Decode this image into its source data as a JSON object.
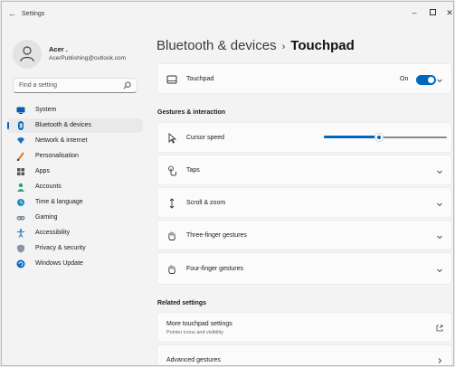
{
  "window": {
    "app_title": "Settings",
    "back_glyph": "←",
    "minimize_glyph": "–",
    "close_glyph": "✕"
  },
  "profile": {
    "name": "Acer .",
    "email": "AcerPublishing@outlook.com"
  },
  "search": {
    "placeholder": "Find a setting",
    "icon": "search-icon"
  },
  "sidebar": {
    "items": [
      {
        "label": "System",
        "icon": "monitor-icon",
        "active": false
      },
      {
        "label": "Bluetooth & devices",
        "icon": "bluetooth-icon",
        "active": true
      },
      {
        "label": "Network & internet",
        "icon": "wifi-icon",
        "active": false
      },
      {
        "label": "Personalisation",
        "icon": "paintbrush-icon",
        "active": false
      },
      {
        "label": "Apps",
        "icon": "apps-icon",
        "active": false
      },
      {
        "label": "Accounts",
        "icon": "person-icon",
        "active": false
      },
      {
        "label": "Time & language",
        "icon": "globe-clock-icon",
        "active": false
      },
      {
        "label": "Gaming",
        "icon": "controller-icon",
        "active": false
      },
      {
        "label": "Accessibility",
        "icon": "accessibility-icon",
        "active": false
      },
      {
        "label": "Privacy & security",
        "icon": "shield-icon",
        "active": false
      },
      {
        "label": "Windows Update",
        "icon": "update-icon",
        "active": false
      }
    ]
  },
  "breadcrumb": {
    "parent": "Bluetooth & devices",
    "separator": "›",
    "current": "Touchpad"
  },
  "touchpad": {
    "label": "Touchpad",
    "state_label": "On",
    "enabled": true
  },
  "gestures": {
    "heading": "Gestures & interaction",
    "cursor_speed_label": "Cursor speed",
    "cursor_speed_value": 0.45,
    "rows": [
      {
        "label": "Taps",
        "icon": "tap-icon"
      },
      {
        "label": "Scroll & zoom",
        "icon": "scroll-icon"
      },
      {
        "label": "Three-finger gestures",
        "icon": "hand-icon"
      },
      {
        "label": "Four-finger gestures",
        "icon": "hand-icon"
      }
    ]
  },
  "related": {
    "heading": "Related settings",
    "more_title": "More touchpad settings",
    "more_subtitle": "Pointer icons and visibility",
    "advanced": "Advanced gestures"
  },
  "colors": {
    "accent": "#0067c0",
    "window_bg": "#f3f3f3",
    "card_bg": "#fbfbfb"
  }
}
